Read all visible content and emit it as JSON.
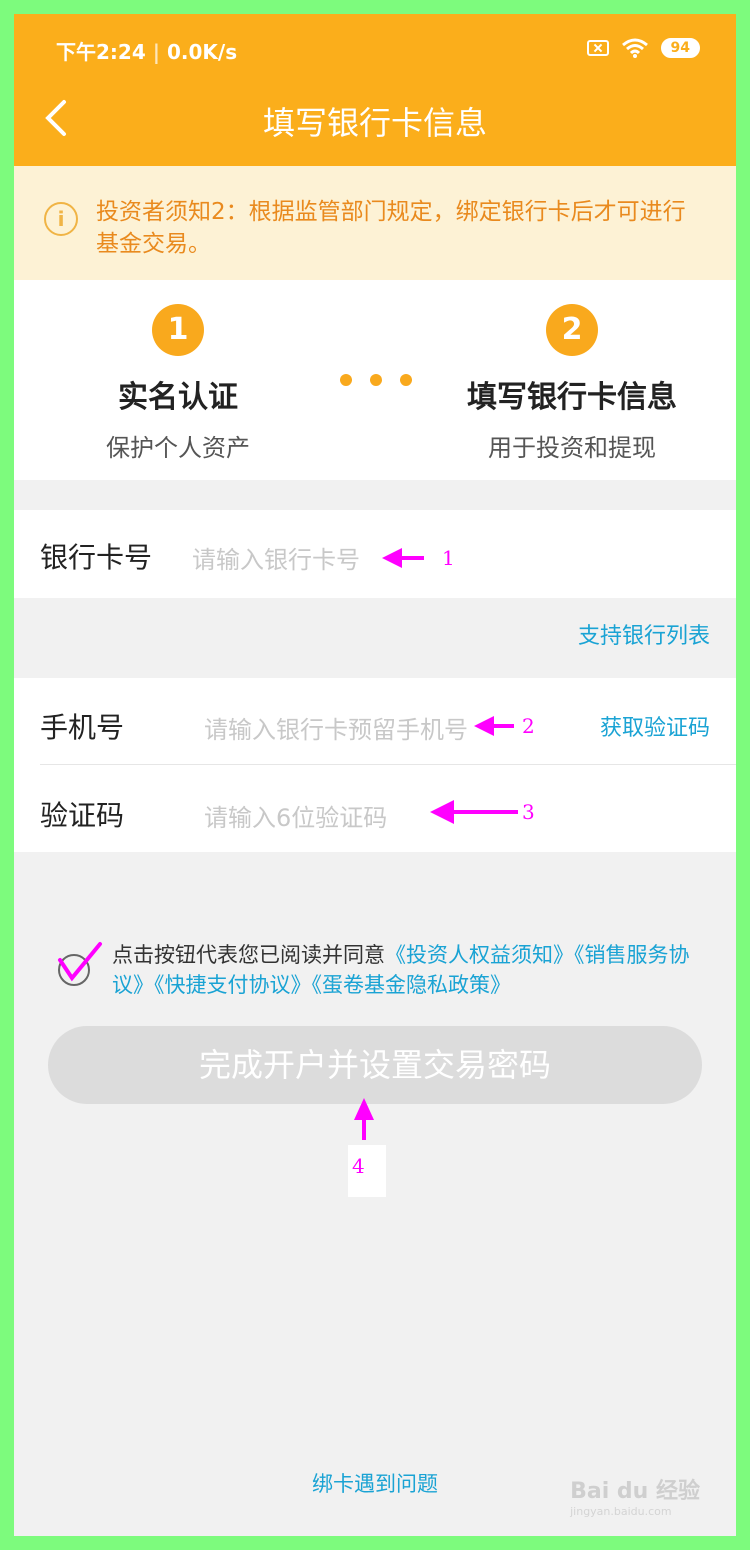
{
  "status_bar": {
    "time": "下午2:24",
    "speed": "0.0K/s",
    "battery": "94"
  },
  "header": {
    "title": "填写银行卡信息"
  },
  "notice": {
    "text": "投资者须知2：根据监管部门规定，绑定银行卡后才可进行基金交易。"
  },
  "steps": [
    {
      "number": "1",
      "title": "实名认证",
      "subtitle": "保护个人资产"
    },
    {
      "number": "2",
      "title": "填写银行卡信息",
      "subtitle": "用于投资和提现"
    }
  ],
  "form": {
    "card_label": "银行卡号",
    "card_placeholder": "请输入银行卡号",
    "bank_list_link": "支持银行列表",
    "phone_label": "手机号",
    "phone_placeholder": "请输入银行卡预留手机号",
    "get_code": "获取验证码",
    "code_label": "验证码",
    "code_placeholder": "请输入6位验证码"
  },
  "agreement": {
    "prefix": "点击按钮代表您已阅读并同意",
    "links": "《投资人权益须知》《销售服务协议》《快捷支付协议》《蛋卷基金隐私政策》"
  },
  "submit_label": "完成开户并设置交易密码",
  "help_link": "绑卡遇到问题",
  "annotations": [
    "1",
    "2",
    "3",
    "4"
  ],
  "watermark": {
    "brand": "Bai du 经验",
    "url": "jingyan.baidu.com"
  },
  "colors": {
    "header": "#fbae1b",
    "accent": "#f9a91d",
    "link": "#1aa3d4",
    "annotation": "#ff00ff"
  }
}
